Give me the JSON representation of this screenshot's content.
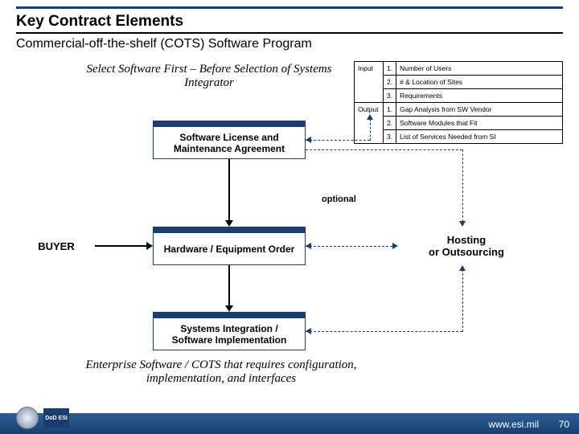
{
  "header": {
    "title": "Key Contract Elements",
    "subtitle": "Commercial-off-the-shelf (COTS) Software Program"
  },
  "lead": "Select Software First – Before Selection of Systems Integrator",
  "io": {
    "input_label": "Input",
    "output_label": "Output",
    "input": [
      {
        "n": "1.",
        "t": "Number of Users"
      },
      {
        "n": "2.",
        "t": "# & Location of Sites"
      },
      {
        "n": "3.",
        "t": "Requirements"
      }
    ],
    "output": [
      {
        "n": "1.",
        "t": "Gap Analysis from SW Vendor"
      },
      {
        "n": "2.",
        "t": "Software Modules that Fit"
      },
      {
        "n": "3.",
        "t": "List of Services Needed from SI"
      }
    ]
  },
  "nodes": {
    "sla": "Software License and Maintenance Agreement",
    "hw": "Hardware / Equipment Order",
    "si": "Systems Integration / Software Implementation",
    "buyer": "BUYER",
    "host": "Hosting\nor Outsourcing"
  },
  "labels": {
    "optional": "optional"
  },
  "footer_note": "Enterprise Software / COTS that requires configuration, implementation, and interfaces",
  "footer": {
    "url": "www.esi.mil",
    "page": "70",
    "esi_logo": "DoD ESI"
  }
}
